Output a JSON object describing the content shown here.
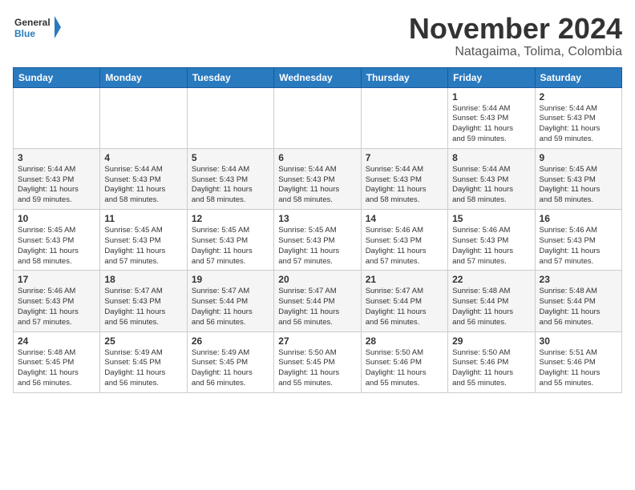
{
  "logo": {
    "general": "General",
    "blue": "Blue"
  },
  "header": {
    "month": "November 2024",
    "location": "Natagaima, Tolima, Colombia"
  },
  "weekdays": [
    "Sunday",
    "Monday",
    "Tuesday",
    "Wednesday",
    "Thursday",
    "Friday",
    "Saturday"
  ],
  "weeks": [
    [
      {
        "day": "",
        "info": ""
      },
      {
        "day": "",
        "info": ""
      },
      {
        "day": "",
        "info": ""
      },
      {
        "day": "",
        "info": ""
      },
      {
        "day": "",
        "info": ""
      },
      {
        "day": "1",
        "info": "Sunrise: 5:44 AM\nSunset: 5:43 PM\nDaylight: 11 hours\nand 59 minutes."
      },
      {
        "day": "2",
        "info": "Sunrise: 5:44 AM\nSunset: 5:43 PM\nDaylight: 11 hours\nand 59 minutes."
      }
    ],
    [
      {
        "day": "3",
        "info": "Sunrise: 5:44 AM\nSunset: 5:43 PM\nDaylight: 11 hours\nand 59 minutes."
      },
      {
        "day": "4",
        "info": "Sunrise: 5:44 AM\nSunset: 5:43 PM\nDaylight: 11 hours\nand 58 minutes."
      },
      {
        "day": "5",
        "info": "Sunrise: 5:44 AM\nSunset: 5:43 PM\nDaylight: 11 hours\nand 58 minutes."
      },
      {
        "day": "6",
        "info": "Sunrise: 5:44 AM\nSunset: 5:43 PM\nDaylight: 11 hours\nand 58 minutes."
      },
      {
        "day": "7",
        "info": "Sunrise: 5:44 AM\nSunset: 5:43 PM\nDaylight: 11 hours\nand 58 minutes."
      },
      {
        "day": "8",
        "info": "Sunrise: 5:44 AM\nSunset: 5:43 PM\nDaylight: 11 hours\nand 58 minutes."
      },
      {
        "day": "9",
        "info": "Sunrise: 5:45 AM\nSunset: 5:43 PM\nDaylight: 11 hours\nand 58 minutes."
      }
    ],
    [
      {
        "day": "10",
        "info": "Sunrise: 5:45 AM\nSunset: 5:43 PM\nDaylight: 11 hours\nand 58 minutes."
      },
      {
        "day": "11",
        "info": "Sunrise: 5:45 AM\nSunset: 5:43 PM\nDaylight: 11 hours\nand 57 minutes."
      },
      {
        "day": "12",
        "info": "Sunrise: 5:45 AM\nSunset: 5:43 PM\nDaylight: 11 hours\nand 57 minutes."
      },
      {
        "day": "13",
        "info": "Sunrise: 5:45 AM\nSunset: 5:43 PM\nDaylight: 11 hours\nand 57 minutes."
      },
      {
        "day": "14",
        "info": "Sunrise: 5:46 AM\nSunset: 5:43 PM\nDaylight: 11 hours\nand 57 minutes."
      },
      {
        "day": "15",
        "info": "Sunrise: 5:46 AM\nSunset: 5:43 PM\nDaylight: 11 hours\nand 57 minutes."
      },
      {
        "day": "16",
        "info": "Sunrise: 5:46 AM\nSunset: 5:43 PM\nDaylight: 11 hours\nand 57 minutes."
      }
    ],
    [
      {
        "day": "17",
        "info": "Sunrise: 5:46 AM\nSunset: 5:43 PM\nDaylight: 11 hours\nand 57 minutes."
      },
      {
        "day": "18",
        "info": "Sunrise: 5:47 AM\nSunset: 5:43 PM\nDaylight: 11 hours\nand 56 minutes."
      },
      {
        "day": "19",
        "info": "Sunrise: 5:47 AM\nSunset: 5:44 PM\nDaylight: 11 hours\nand 56 minutes."
      },
      {
        "day": "20",
        "info": "Sunrise: 5:47 AM\nSunset: 5:44 PM\nDaylight: 11 hours\nand 56 minutes."
      },
      {
        "day": "21",
        "info": "Sunrise: 5:47 AM\nSunset: 5:44 PM\nDaylight: 11 hours\nand 56 minutes."
      },
      {
        "day": "22",
        "info": "Sunrise: 5:48 AM\nSunset: 5:44 PM\nDaylight: 11 hours\nand 56 minutes."
      },
      {
        "day": "23",
        "info": "Sunrise: 5:48 AM\nSunset: 5:44 PM\nDaylight: 11 hours\nand 56 minutes."
      }
    ],
    [
      {
        "day": "24",
        "info": "Sunrise: 5:48 AM\nSunset: 5:45 PM\nDaylight: 11 hours\nand 56 minutes."
      },
      {
        "day": "25",
        "info": "Sunrise: 5:49 AM\nSunset: 5:45 PM\nDaylight: 11 hours\nand 56 minutes."
      },
      {
        "day": "26",
        "info": "Sunrise: 5:49 AM\nSunset: 5:45 PM\nDaylight: 11 hours\nand 56 minutes."
      },
      {
        "day": "27",
        "info": "Sunrise: 5:50 AM\nSunset: 5:45 PM\nDaylight: 11 hours\nand 55 minutes."
      },
      {
        "day": "28",
        "info": "Sunrise: 5:50 AM\nSunset: 5:46 PM\nDaylight: 11 hours\nand 55 minutes."
      },
      {
        "day": "29",
        "info": "Sunrise: 5:50 AM\nSunset: 5:46 PM\nDaylight: 11 hours\nand 55 minutes."
      },
      {
        "day": "30",
        "info": "Sunrise: 5:51 AM\nSunset: 5:46 PM\nDaylight: 11 hours\nand 55 minutes."
      }
    ]
  ]
}
